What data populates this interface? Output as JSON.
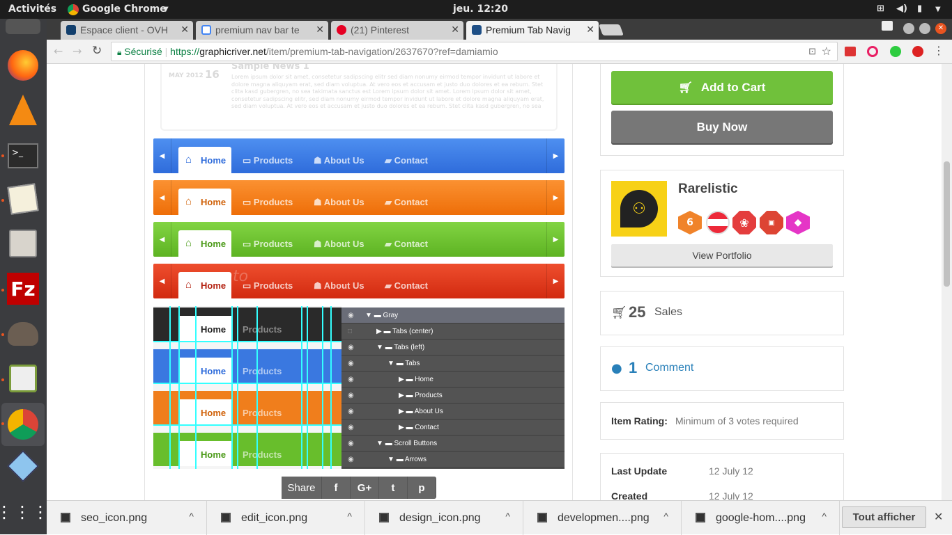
{
  "system": {
    "activities": "Activités",
    "app_menu": "Google Chrome",
    "clock": "jeu. 12:20"
  },
  "tabs": [
    {
      "label": "Espace client - OVH",
      "active": false
    },
    {
      "label": "premium nav bar te",
      "active": false
    },
    {
      "label": "(21) Pinterest",
      "active": false
    },
    {
      "label": "Premium Tab Navig",
      "active": true
    }
  ],
  "toolbar": {
    "secure_label": "Sécurisé",
    "url_scheme": "https://",
    "url_host": "graphicriver.net",
    "url_path": "/item/premium-tab-navigation/2637670?ref=damiamio"
  },
  "preview": {
    "sample_date": "MAY 2012",
    "sample_day": "16",
    "sample_title": "Sample News 1",
    "sample_text": "Lorem ipsum dolor sit amet, consetetur sadipscing elitr sed diam nonumy eirmod tempor invidunt ut labore et dolore magna aliquyam erat, sed diam voluptua. At vero eos et accusam et justo duo dolores et ea rebum. Stet clita kasd gubergren, no sea takimata sanctus est Lorem ipsum dolor sit amet. Lorem ipsum dolor sit amet, consetetur sadipscing elitr, sed diam nonumy eirmod tempor invidunt ut labore et dolore magna aliquyam erat, sed diam voluptua. At vero eos et accusam et justo duo dolores et ea rebum. Stet clita kasd gubergren, no sea",
    "nav_items": [
      "Home",
      "Products",
      "About Us",
      "Contact"
    ],
    "watermark": "envato",
    "layers": [
      {
        "label": "Gray",
        "indent": 0,
        "kind": "open"
      },
      {
        "label": "Tabs (center)",
        "indent": 1,
        "kind": "closed"
      },
      {
        "label": "Tabs (left)",
        "indent": 1,
        "kind": "open"
      },
      {
        "label": "Tabs",
        "indent": 2,
        "kind": "open"
      },
      {
        "label": "Home",
        "indent": 3,
        "kind": "closed"
      },
      {
        "label": "Products",
        "indent": 3,
        "kind": "closed"
      },
      {
        "label": "About Us",
        "indent": 3,
        "kind": "closed"
      },
      {
        "label": "Contact",
        "indent": 3,
        "kind": "closed"
      },
      {
        "label": "Scroll Buttons",
        "indent": 1,
        "kind": "open"
      },
      {
        "label": "Arrows",
        "indent": 2,
        "kind": "open"
      }
    ]
  },
  "share": {
    "label": "Share",
    "facebook": "f",
    "googleplus": "G+",
    "twitter": "t",
    "pinterest": "p"
  },
  "sidebar": {
    "add_to_cart": "Add to Cart",
    "buy_now": "Buy Now",
    "author": "Rarelistic",
    "view_portfolio": "View Portfolio",
    "badge_years": "6",
    "sales_count": "25",
    "sales_label": "Sales",
    "comment_count": "1",
    "comment_label": "Comment",
    "rating_label": "Item Rating:",
    "rating_value": "Minimum of 3 votes required",
    "last_update_label": "Last Update",
    "last_update_value": "12 July 12",
    "created_label": "Created",
    "created_value": "12 July 12"
  },
  "downloads": {
    "items": [
      "seo_icon.png",
      "edit_icon.png",
      "design_icon.png",
      "developmen....png",
      "google-hom....png"
    ],
    "show_all": "Tout afficher"
  },
  "colors": {
    "blue": "#3f7fe8",
    "orange": "#f37e1a",
    "green": "#6cc231",
    "red": "#e2361c",
    "cart_green": "#70c13b",
    "link_blue": "#2980b9"
  }
}
